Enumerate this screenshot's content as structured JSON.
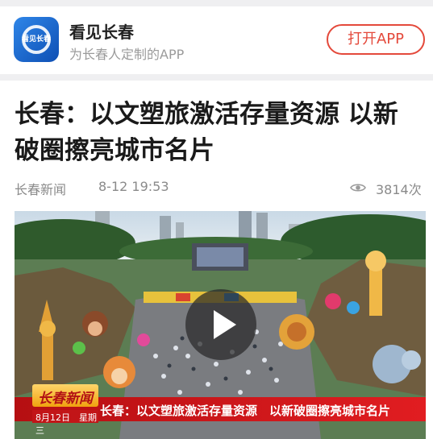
{
  "app_banner": {
    "name": "看见长春",
    "tagline": "为长春人定制的APP",
    "open_button": "打开APP",
    "logo_text": "看见长春",
    "accent_color": "#e4493b"
  },
  "article": {
    "title": "长春：以文塑旅激活存量资源 以新破圈擦亮城市名片",
    "source": "长春新闻",
    "date": "8-12 19:53",
    "views": "3814次",
    "views_icon": "eye-icon"
  },
  "video": {
    "caption": "长春：以文塑旅激活存量资源　以新破圈擦亮城市名片",
    "program_logo": "长春新闻",
    "date_strip": "8月12日　星期三",
    "play_icon": "play-icon"
  }
}
